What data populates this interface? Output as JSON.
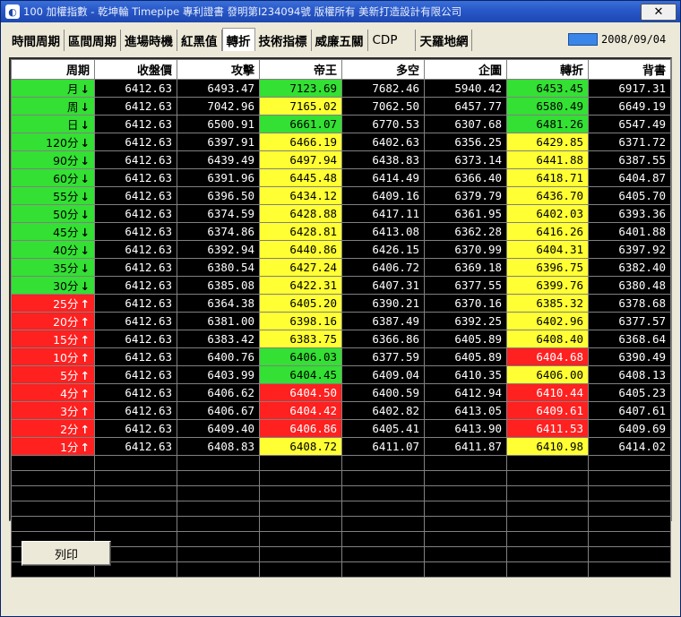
{
  "window": {
    "title": "100 加權指數 - 乾坤輪 Timepipe 專利證書 發明第I234094號 版權所有 美新打造設計有限公司",
    "close_label": "✕"
  },
  "tabs": [
    {
      "label": "時間周期",
      "active": false
    },
    {
      "label": "區間周期",
      "active": false
    },
    {
      "label": "進場時機",
      "active": false
    },
    {
      "label": "紅黑值",
      "active": false
    },
    {
      "label": "轉折",
      "active": true
    },
    {
      "label": "技術指標",
      "active": false
    },
    {
      "label": "威廉五關",
      "active": false
    },
    {
      "label": "CDP",
      "active": false
    },
    {
      "label": "天羅地網",
      "active": false
    }
  ],
  "date": "2008/09/04",
  "table": {
    "headers": [
      "周期",
      "收盤價",
      "攻擊",
      "帝王",
      "多空",
      "企圖",
      "轉折",
      "背書"
    ],
    "rows": [
      {
        "period": "月",
        "dir": "down",
        "pc": "green",
        "cells": [
          [
            "6412.63",
            "black"
          ],
          [
            "6493.47",
            "black"
          ],
          [
            "7123.69",
            "green"
          ],
          [
            "7682.46",
            "black"
          ],
          [
            "5940.42",
            "black"
          ],
          [
            "6453.45",
            "green"
          ],
          [
            "6917.31",
            "black"
          ]
        ]
      },
      {
        "period": "周",
        "dir": "down",
        "pc": "green",
        "cells": [
          [
            "6412.63",
            "black"
          ],
          [
            "7042.96",
            "black"
          ],
          [
            "7165.02",
            "yellow"
          ],
          [
            "7062.50",
            "black"
          ],
          [
            "6457.77",
            "black"
          ],
          [
            "6580.49",
            "green"
          ],
          [
            "6649.19",
            "black"
          ]
        ]
      },
      {
        "period": "日",
        "dir": "down",
        "pc": "green",
        "cells": [
          [
            "6412.63",
            "black"
          ],
          [
            "6500.91",
            "black"
          ],
          [
            "6661.07",
            "green"
          ],
          [
            "6770.53",
            "black"
          ],
          [
            "6307.68",
            "black"
          ],
          [
            "6481.26",
            "green"
          ],
          [
            "6547.49",
            "black"
          ]
        ]
      },
      {
        "period": "120分",
        "dir": "down",
        "pc": "green",
        "cells": [
          [
            "6412.63",
            "black"
          ],
          [
            "6397.91",
            "black"
          ],
          [
            "6466.19",
            "yellow"
          ],
          [
            "6402.63",
            "black"
          ],
          [
            "6356.25",
            "black"
          ],
          [
            "6429.85",
            "yellow"
          ],
          [
            "6371.72",
            "black"
          ]
        ]
      },
      {
        "period": "90分",
        "dir": "down",
        "pc": "green",
        "cells": [
          [
            "6412.63",
            "black"
          ],
          [
            "6439.49",
            "black"
          ],
          [
            "6497.94",
            "yellow"
          ],
          [
            "6438.83",
            "black"
          ],
          [
            "6373.14",
            "black"
          ],
          [
            "6441.88",
            "yellow"
          ],
          [
            "6387.55",
            "black"
          ]
        ]
      },
      {
        "period": "60分",
        "dir": "down",
        "pc": "green",
        "cells": [
          [
            "6412.63",
            "black"
          ],
          [
            "6391.96",
            "black"
          ],
          [
            "6445.48",
            "yellow"
          ],
          [
            "6414.49",
            "black"
          ],
          [
            "6366.40",
            "black"
          ],
          [
            "6418.71",
            "yellow"
          ],
          [
            "6404.87",
            "black"
          ]
        ]
      },
      {
        "period": "55分",
        "dir": "down",
        "pc": "green",
        "cells": [
          [
            "6412.63",
            "black"
          ],
          [
            "6396.50",
            "black"
          ],
          [
            "6434.12",
            "yellow"
          ],
          [
            "6409.16",
            "black"
          ],
          [
            "6379.79",
            "black"
          ],
          [
            "6436.70",
            "yellow"
          ],
          [
            "6405.70",
            "black"
          ]
        ]
      },
      {
        "period": "50分",
        "dir": "down",
        "pc": "green",
        "cells": [
          [
            "6412.63",
            "black"
          ],
          [
            "6374.59",
            "black"
          ],
          [
            "6428.88",
            "yellow"
          ],
          [
            "6417.11",
            "black"
          ],
          [
            "6361.95",
            "black"
          ],
          [
            "6402.03",
            "yellow"
          ],
          [
            "6393.36",
            "black"
          ]
        ]
      },
      {
        "period": "45分",
        "dir": "down",
        "pc": "green",
        "cells": [
          [
            "6412.63",
            "black"
          ],
          [
            "6374.86",
            "black"
          ],
          [
            "6428.81",
            "yellow"
          ],
          [
            "6413.08",
            "black"
          ],
          [
            "6362.28",
            "black"
          ],
          [
            "6416.26",
            "yellow"
          ],
          [
            "6401.88",
            "black"
          ]
        ]
      },
      {
        "period": "40分",
        "dir": "down",
        "pc": "green",
        "cells": [
          [
            "6412.63",
            "black"
          ],
          [
            "6392.94",
            "black"
          ],
          [
            "6440.86",
            "yellow"
          ],
          [
            "6426.15",
            "black"
          ],
          [
            "6370.99",
            "black"
          ],
          [
            "6404.31",
            "yellow"
          ],
          [
            "6397.92",
            "black"
          ]
        ]
      },
      {
        "period": "35分",
        "dir": "down",
        "pc": "green",
        "cells": [
          [
            "6412.63",
            "black"
          ],
          [
            "6380.54",
            "black"
          ],
          [
            "6427.24",
            "yellow"
          ],
          [
            "6406.72",
            "black"
          ],
          [
            "6369.18",
            "black"
          ],
          [
            "6396.75",
            "yellow"
          ],
          [
            "6382.40",
            "black"
          ]
        ]
      },
      {
        "period": "30分",
        "dir": "down",
        "pc": "green",
        "cells": [
          [
            "6412.63",
            "black"
          ],
          [
            "6385.08",
            "black"
          ],
          [
            "6422.31",
            "yellow"
          ],
          [
            "6407.31",
            "black"
          ],
          [
            "6377.55",
            "black"
          ],
          [
            "6399.76",
            "yellow"
          ],
          [
            "6380.48",
            "black"
          ]
        ]
      },
      {
        "period": "25分",
        "dir": "up",
        "pc": "red",
        "cells": [
          [
            "6412.63",
            "black"
          ],
          [
            "6364.38",
            "black"
          ],
          [
            "6405.20",
            "yellow"
          ],
          [
            "6390.21",
            "black"
          ],
          [
            "6370.16",
            "black"
          ],
          [
            "6385.32",
            "yellow"
          ],
          [
            "6378.68",
            "black"
          ]
        ]
      },
      {
        "period": "20分",
        "dir": "up",
        "pc": "red",
        "cells": [
          [
            "6412.63",
            "black"
          ],
          [
            "6381.00",
            "black"
          ],
          [
            "6398.16",
            "yellow"
          ],
          [
            "6387.49",
            "black"
          ],
          [
            "6392.25",
            "black"
          ],
          [
            "6402.96",
            "yellow"
          ],
          [
            "6377.57",
            "black"
          ]
        ]
      },
      {
        "period": "15分",
        "dir": "up",
        "pc": "red",
        "cells": [
          [
            "6412.63",
            "black"
          ],
          [
            "6383.42",
            "black"
          ],
          [
            "6383.75",
            "yellow"
          ],
          [
            "6366.86",
            "black"
          ],
          [
            "6405.89",
            "black"
          ],
          [
            "6408.40",
            "yellow"
          ],
          [
            "6368.64",
            "black"
          ]
        ]
      },
      {
        "period": "10分",
        "dir": "up",
        "pc": "red",
        "cells": [
          [
            "6412.63",
            "black"
          ],
          [
            "6400.76",
            "black"
          ],
          [
            "6406.03",
            "green"
          ],
          [
            "6377.59",
            "black"
          ],
          [
            "6405.89",
            "black"
          ],
          [
            "6404.68",
            "red"
          ],
          [
            "6390.49",
            "black"
          ]
        ]
      },
      {
        "period": "5分",
        "dir": "up",
        "pc": "red",
        "cells": [
          [
            "6412.63",
            "black"
          ],
          [
            "6403.99",
            "black"
          ],
          [
            "6404.45",
            "green"
          ],
          [
            "6409.04",
            "black"
          ],
          [
            "6410.35",
            "black"
          ],
          [
            "6406.00",
            "yellow"
          ],
          [
            "6408.13",
            "black"
          ]
        ]
      },
      {
        "period": "4分",
        "dir": "up",
        "pc": "red",
        "cells": [
          [
            "6412.63",
            "black"
          ],
          [
            "6406.62",
            "black"
          ],
          [
            "6404.50",
            "red"
          ],
          [
            "6400.59",
            "black"
          ],
          [
            "6412.94",
            "black"
          ],
          [
            "6410.44",
            "red"
          ],
          [
            "6405.23",
            "black"
          ]
        ]
      },
      {
        "period": "3分",
        "dir": "up",
        "pc": "red",
        "cells": [
          [
            "6412.63",
            "black"
          ],
          [
            "6406.67",
            "black"
          ],
          [
            "6404.42",
            "red"
          ],
          [
            "6402.82",
            "black"
          ],
          [
            "6413.05",
            "black"
          ],
          [
            "6409.61",
            "red"
          ],
          [
            "6407.61",
            "black"
          ]
        ]
      },
      {
        "period": "2分",
        "dir": "up",
        "pc": "red",
        "cells": [
          [
            "6412.63",
            "black"
          ],
          [
            "6409.40",
            "black"
          ],
          [
            "6406.86",
            "red"
          ],
          [
            "6405.41",
            "black"
          ],
          [
            "6413.90",
            "black"
          ],
          [
            "6411.53",
            "red"
          ],
          [
            "6409.69",
            "black"
          ]
        ]
      },
      {
        "period": "1分",
        "dir": "up",
        "pc": "red",
        "cells": [
          [
            "6412.63",
            "black"
          ],
          [
            "6408.83",
            "black"
          ],
          [
            "6408.72",
            "yellow"
          ],
          [
            "6411.07",
            "black"
          ],
          [
            "6411.87",
            "black"
          ],
          [
            "6410.98",
            "yellow"
          ],
          [
            "6414.02",
            "black"
          ]
        ]
      }
    ],
    "empty_rows": 8
  },
  "print_button": "列印",
  "icons": {
    "app": "app-icon",
    "down": "arrow-down-icon",
    "up": "arrow-up-icon"
  },
  "colors": {
    "green": "#33e033",
    "yellow": "#ffff33",
    "red": "#ff2020",
    "black": "#000000",
    "date_indicator": "#3a86e8"
  }
}
